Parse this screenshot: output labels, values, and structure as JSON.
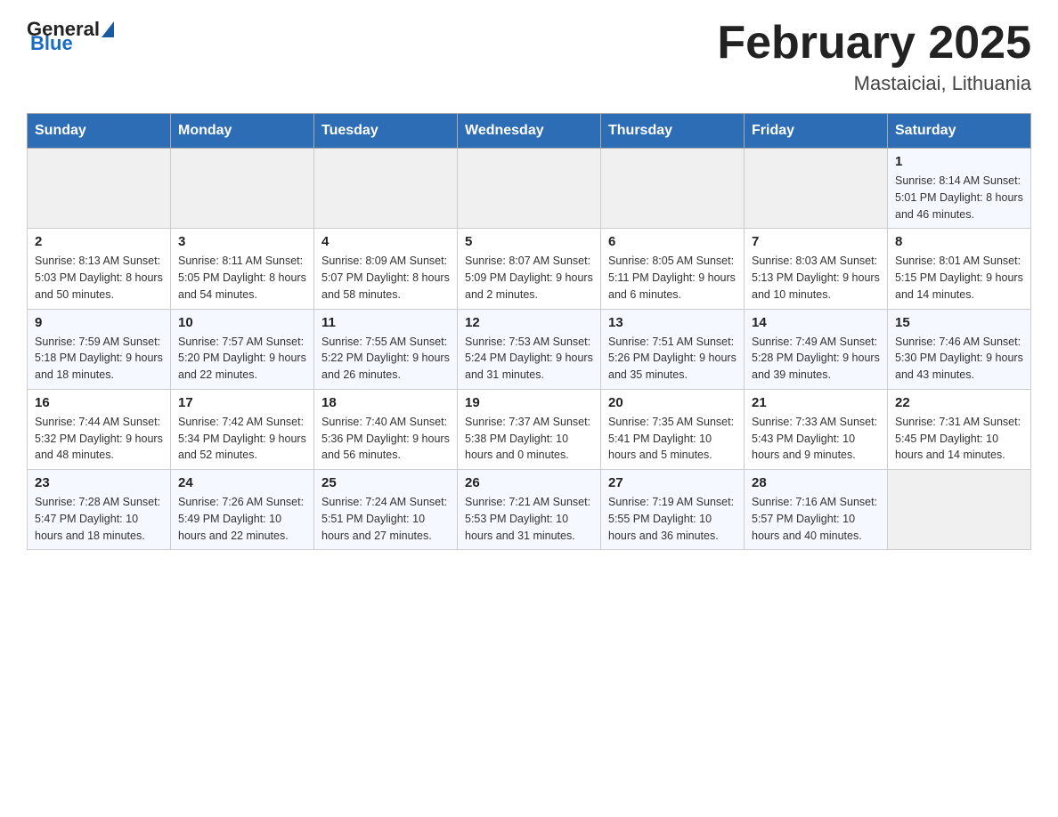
{
  "header": {
    "logo_general": "General",
    "logo_blue": "Blue",
    "month_title": "February 2025",
    "location": "Mastaiciai, Lithuania"
  },
  "days_of_week": [
    "Sunday",
    "Monday",
    "Tuesday",
    "Wednesday",
    "Thursday",
    "Friday",
    "Saturday"
  ],
  "weeks": [
    [
      {
        "day": "",
        "info": ""
      },
      {
        "day": "",
        "info": ""
      },
      {
        "day": "",
        "info": ""
      },
      {
        "day": "",
        "info": ""
      },
      {
        "day": "",
        "info": ""
      },
      {
        "day": "",
        "info": ""
      },
      {
        "day": "1",
        "info": "Sunrise: 8:14 AM\nSunset: 5:01 PM\nDaylight: 8 hours and 46 minutes."
      }
    ],
    [
      {
        "day": "2",
        "info": "Sunrise: 8:13 AM\nSunset: 5:03 PM\nDaylight: 8 hours and 50 minutes."
      },
      {
        "day": "3",
        "info": "Sunrise: 8:11 AM\nSunset: 5:05 PM\nDaylight: 8 hours and 54 minutes."
      },
      {
        "day": "4",
        "info": "Sunrise: 8:09 AM\nSunset: 5:07 PM\nDaylight: 8 hours and 58 minutes."
      },
      {
        "day": "5",
        "info": "Sunrise: 8:07 AM\nSunset: 5:09 PM\nDaylight: 9 hours and 2 minutes."
      },
      {
        "day": "6",
        "info": "Sunrise: 8:05 AM\nSunset: 5:11 PM\nDaylight: 9 hours and 6 minutes."
      },
      {
        "day": "7",
        "info": "Sunrise: 8:03 AM\nSunset: 5:13 PM\nDaylight: 9 hours and 10 minutes."
      },
      {
        "day": "8",
        "info": "Sunrise: 8:01 AM\nSunset: 5:15 PM\nDaylight: 9 hours and 14 minutes."
      }
    ],
    [
      {
        "day": "9",
        "info": "Sunrise: 7:59 AM\nSunset: 5:18 PM\nDaylight: 9 hours and 18 minutes."
      },
      {
        "day": "10",
        "info": "Sunrise: 7:57 AM\nSunset: 5:20 PM\nDaylight: 9 hours and 22 minutes."
      },
      {
        "day": "11",
        "info": "Sunrise: 7:55 AM\nSunset: 5:22 PM\nDaylight: 9 hours and 26 minutes."
      },
      {
        "day": "12",
        "info": "Sunrise: 7:53 AM\nSunset: 5:24 PM\nDaylight: 9 hours and 31 minutes."
      },
      {
        "day": "13",
        "info": "Sunrise: 7:51 AM\nSunset: 5:26 PM\nDaylight: 9 hours and 35 minutes."
      },
      {
        "day": "14",
        "info": "Sunrise: 7:49 AM\nSunset: 5:28 PM\nDaylight: 9 hours and 39 minutes."
      },
      {
        "day": "15",
        "info": "Sunrise: 7:46 AM\nSunset: 5:30 PM\nDaylight: 9 hours and 43 minutes."
      }
    ],
    [
      {
        "day": "16",
        "info": "Sunrise: 7:44 AM\nSunset: 5:32 PM\nDaylight: 9 hours and 48 minutes."
      },
      {
        "day": "17",
        "info": "Sunrise: 7:42 AM\nSunset: 5:34 PM\nDaylight: 9 hours and 52 minutes."
      },
      {
        "day": "18",
        "info": "Sunrise: 7:40 AM\nSunset: 5:36 PM\nDaylight: 9 hours and 56 minutes."
      },
      {
        "day": "19",
        "info": "Sunrise: 7:37 AM\nSunset: 5:38 PM\nDaylight: 10 hours and 0 minutes."
      },
      {
        "day": "20",
        "info": "Sunrise: 7:35 AM\nSunset: 5:41 PM\nDaylight: 10 hours and 5 minutes."
      },
      {
        "day": "21",
        "info": "Sunrise: 7:33 AM\nSunset: 5:43 PM\nDaylight: 10 hours and 9 minutes."
      },
      {
        "day": "22",
        "info": "Sunrise: 7:31 AM\nSunset: 5:45 PM\nDaylight: 10 hours and 14 minutes."
      }
    ],
    [
      {
        "day": "23",
        "info": "Sunrise: 7:28 AM\nSunset: 5:47 PM\nDaylight: 10 hours and 18 minutes."
      },
      {
        "day": "24",
        "info": "Sunrise: 7:26 AM\nSunset: 5:49 PM\nDaylight: 10 hours and 22 minutes."
      },
      {
        "day": "25",
        "info": "Sunrise: 7:24 AM\nSunset: 5:51 PM\nDaylight: 10 hours and 27 minutes."
      },
      {
        "day": "26",
        "info": "Sunrise: 7:21 AM\nSunset: 5:53 PM\nDaylight: 10 hours and 31 minutes."
      },
      {
        "day": "27",
        "info": "Sunrise: 7:19 AM\nSunset: 5:55 PM\nDaylight: 10 hours and 36 minutes."
      },
      {
        "day": "28",
        "info": "Sunrise: 7:16 AM\nSunset: 5:57 PM\nDaylight: 10 hours and 40 minutes."
      },
      {
        "day": "",
        "info": ""
      }
    ]
  ]
}
